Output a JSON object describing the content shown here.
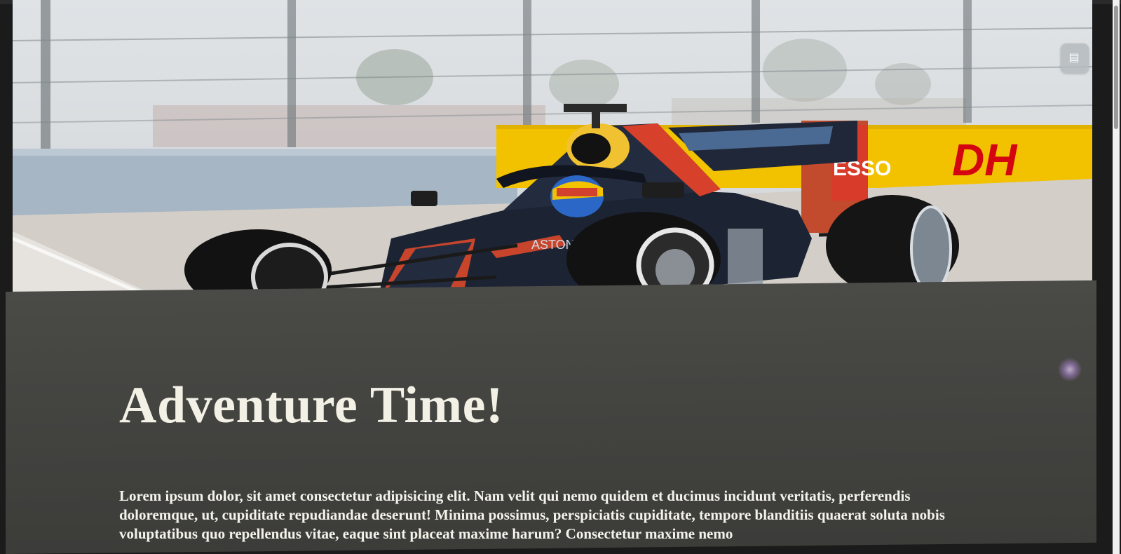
{
  "hero": {
    "image_alt": "Formula 1 race car on track",
    "car_text_aston": "ASTON MA",
    "wing_text": "ESSO",
    "banner_text": "DH"
  },
  "article": {
    "title": "Adventure Time!",
    "body": "Lorem ipsum dolor, sit amet consectetur adipisicing elit. Nam velit qui nemo quidem et ducimus incidunt veritatis, perferendis doloremque, ut, cupiditate repudiandae deserunt! Minima possimus, perspiciatis cupiditate, tempore blanditiis quaerat soluta nobis voluptatibus quo repellendus vitae, eaque sint placeat maxime harum? Consectetur maxime nemo"
  },
  "colors": {
    "section_bg": "#454542",
    "title_color": "#f3f1e6",
    "text_color": "#f5f4ec",
    "banner_yellow": "#f2c200",
    "banner_red": "#d40511"
  },
  "icons": {
    "floating_button": "layers-icon",
    "favicon": "folder-icon"
  }
}
